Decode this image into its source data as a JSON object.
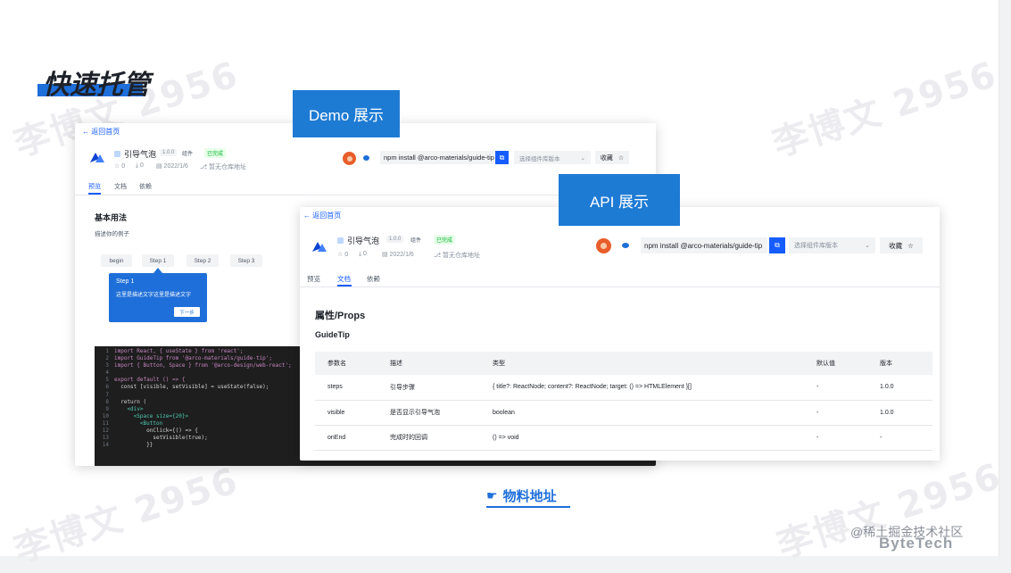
{
  "slide": {
    "title": "快速托管",
    "watermark": "李博文 2956",
    "link_label": "物料地址",
    "link_icon": "pointing-hand-icon",
    "footer_community": "@稀土掘金技术社区",
    "footer_brand": "ByteTech"
  },
  "tags": {
    "demo": "Demo 展示",
    "api": "API 展示"
  },
  "colors": {
    "accent": "#1e6fd9",
    "tag_bg": "#1e7bd4",
    "primary": "#165dff",
    "success": "#00b42a"
  },
  "demo_card": {
    "back": "← 返回首页",
    "name": "引导气泡",
    "version": "1.0.0",
    "category": "组件",
    "status": "已完成",
    "stars": "☆ 0",
    "downloads": "⤓ 0",
    "date": "▤ 2022/1/6",
    "repo": "⎇ 暂无仓库地址",
    "install": "npm install @arco-materials/guide-tip",
    "copy_icon": "copy-icon",
    "select_placeholder": "选择组件库版本",
    "favorite": "收藏",
    "star_icon": "star-icon",
    "tabs": [
      "预览",
      "文档",
      "依赖"
    ],
    "section_title": "基本用法",
    "section_desc": "描述你的例子",
    "steps": [
      "begin",
      "Step 1",
      "Step 2",
      "Step 3"
    ],
    "tip_title": "Step 1",
    "tip_text": "这里是描述文字这里是描述文字",
    "tip_button": "下一步",
    "code": [
      {
        "n": "1",
        "t": "import React, { useState } from 'react';"
      },
      {
        "n": "2",
        "t": "import GuideTip from '@arco-materials/guide-tip';"
      },
      {
        "n": "3",
        "t": "import { Button, Space } from '@arco-design/web-react';"
      },
      {
        "n": "4",
        "t": ""
      },
      {
        "n": "5",
        "t": "export default () => {"
      },
      {
        "n": "6",
        "t": "  const [visible, setVisible] = useState(false);"
      },
      {
        "n": "7",
        "t": ""
      },
      {
        "n": "8",
        "t": "  return ("
      },
      {
        "n": "9",
        "t": "    <div>"
      },
      {
        "n": "10",
        "t": "      <Space size={20}>"
      },
      {
        "n": "11",
        "t": "        <Button"
      },
      {
        "n": "12",
        "t": "          onClick={() => {"
      },
      {
        "n": "13",
        "t": "            setVisible(true);"
      },
      {
        "n": "14",
        "t": "          }}"
      }
    ]
  },
  "api_card": {
    "back": "← 返回首页",
    "name": "引导气泡",
    "version": "1.0.0",
    "category": "组件",
    "status": "已完成",
    "stars": "☆ 0",
    "downloads": "⤓ 0",
    "date": "▤ 2022/1/6",
    "repo": "⎇ 暂无仓库地址",
    "install": "npm install @arco-materials/guide-tip",
    "copy_icon": "copy-icon",
    "select_placeholder": "选择组件库版本",
    "favorite": "收藏",
    "star_icon": "star-icon",
    "tabs": [
      "预览",
      "文档",
      "依赖"
    ],
    "props_title": "属性/Props",
    "component_name": "GuideTip",
    "table": {
      "headers": [
        "参数名",
        "描述",
        "类型",
        "默认值",
        "版本"
      ],
      "rows": [
        [
          "steps",
          "引导步骤",
          "{ title?: ReactNode; content?: ReactNode; target: () => HTMLElement }[]",
          "-",
          "1.0.0"
        ],
        [
          "visible",
          "是否显示引导气泡",
          "boolean",
          "-",
          "1.0.0"
        ],
        [
          "onEnd",
          "完成时的回调",
          "() => void",
          "-",
          "-"
        ]
      ]
    }
  }
}
